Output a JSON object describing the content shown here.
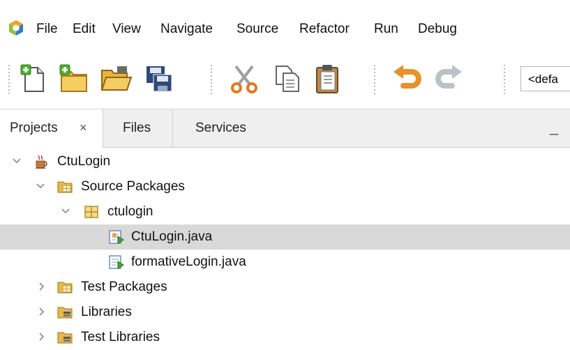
{
  "menu": {
    "items": [
      "File",
      "Edit",
      "View",
      "Navigate",
      "Source",
      "Refactor",
      "Run",
      "Debug"
    ]
  },
  "toolbar": {
    "buttons": [
      "new-file-icon",
      "new-project-icon",
      "open-project-icon",
      "save-all-icon",
      "cut-icon",
      "copy-icon",
      "paste-icon",
      "undo-icon",
      "redo-icon"
    ],
    "config_value": "<defa"
  },
  "tabs": {
    "projects": "Projects",
    "files": "Files",
    "services": "Services",
    "close_glyph": "×",
    "minimize_glyph": "_"
  },
  "tree": {
    "nodes": [
      {
        "label": "CtuLogin",
        "icon": "java-project-icon",
        "expanded": true
      },
      {
        "label": "Source Packages",
        "icon": "source-packages-icon",
        "expanded": true
      },
      {
        "label": "ctulogin",
        "icon": "package-icon",
        "expanded": true
      },
      {
        "label": "CtuLogin.java",
        "icon": "java-main-class-icon",
        "selected": true
      },
      {
        "label": "formativeLogin.java",
        "icon": "java-class-icon"
      },
      {
        "label": "Test Packages",
        "icon": "test-packages-icon",
        "expanded": false
      },
      {
        "label": "Libraries",
        "icon": "libraries-icon",
        "expanded": false
      },
      {
        "label": "Test Libraries",
        "icon": "test-libraries-icon",
        "expanded": false
      }
    ]
  },
  "colors": {
    "selection": "#d9d9d9",
    "tab_bar": "#efefef",
    "folder_yellow": "#f2c14e",
    "scissors_orange": "#e07a1f"
  }
}
